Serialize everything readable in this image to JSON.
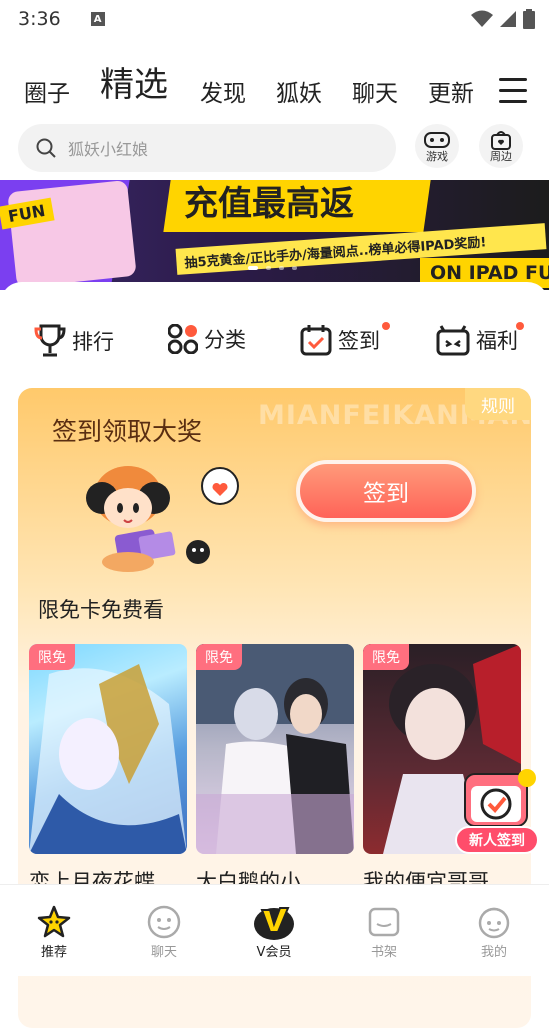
{
  "status": {
    "time": "3:36"
  },
  "tabs": [
    "圈子",
    "精选",
    "发现",
    "狐妖",
    "聊天",
    "更新"
  ],
  "search": {
    "placeholder": "狐妖小红娘"
  },
  "quick": {
    "game": "游戏",
    "merch": "周边"
  },
  "banner": {
    "headline": "充值最高返",
    "sub": "抽5克黄金/正比手办/海量阅点..榜单必得IPAD奖励!",
    "tag_left": "FUN",
    "tag_right": "ON IPAD FU"
  },
  "categories": [
    {
      "label": "排行",
      "dot": false
    },
    {
      "label": "分类",
      "dot": false
    },
    {
      "label": "签到",
      "dot": true
    },
    {
      "label": "福利",
      "dot": true
    }
  ],
  "signin": {
    "title": "签到领取大奖",
    "rules": "规则",
    "watermark": "MIANFEIKANMAN",
    "button": "签到"
  },
  "free": {
    "title": "限免卡免费看",
    "tag": "限免",
    "comics": [
      {
        "title": "恋上月夜花蝶"
      },
      {
        "title": "大白鹅的小"
      },
      {
        "title": "我的便宜哥哥"
      }
    ]
  },
  "new_user_badge": "新人签到",
  "nav": [
    "推荐",
    "聊天",
    "V会员",
    "书架",
    "我的"
  ],
  "colors": {
    "accent": "#ff6358",
    "brand_yellow": "#ffd400",
    "dot": "#ff5a3c"
  }
}
